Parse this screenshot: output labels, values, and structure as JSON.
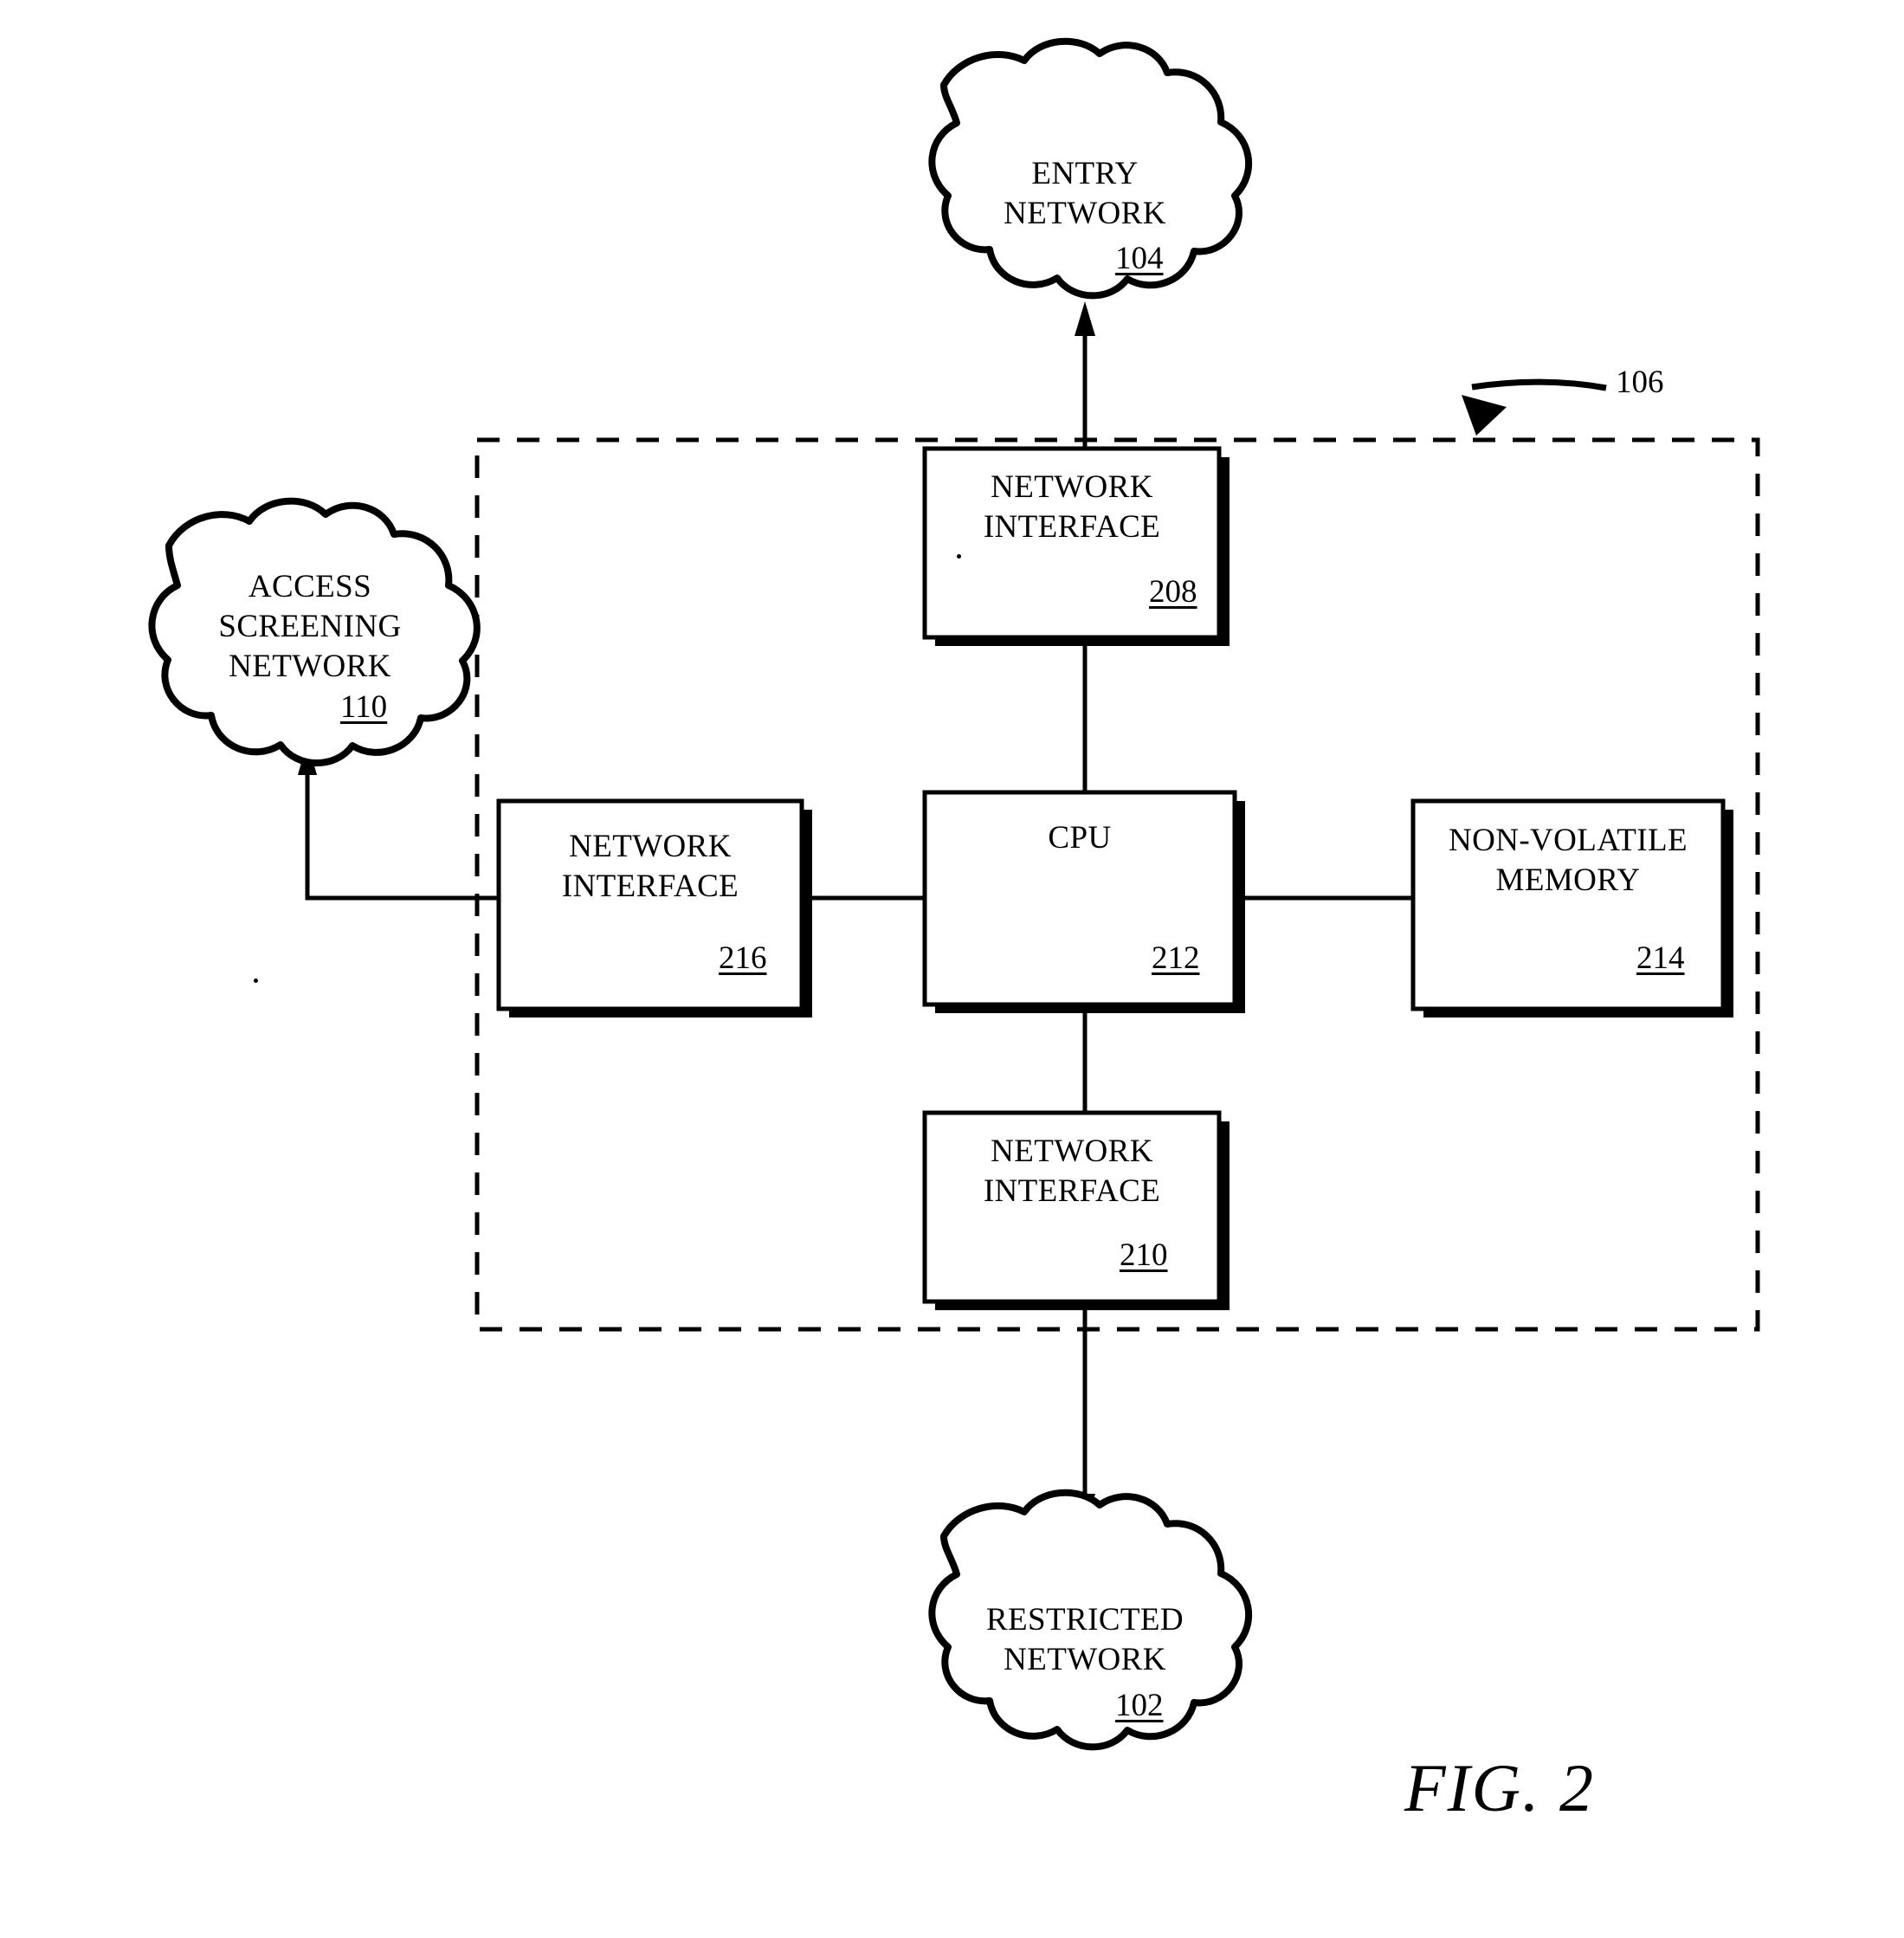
{
  "figure": {
    "caption": "FIG. 2",
    "boundary_ref": "106"
  },
  "clouds": [
    {
      "id": "entry-network",
      "label": "ENTRY\nNETWORK",
      "ref": "104"
    },
    {
      "id": "access-screening-network",
      "label": "ACCESS\nSCREENING\nNETWORK",
      "ref": "110"
    },
    {
      "id": "restricted-network",
      "label": "RESTRICTED\nNETWORK",
      "ref": "102"
    }
  ],
  "boxes": [
    {
      "id": "network-interface-208",
      "label": "NETWORK\nINTERFACE",
      "ref": "208"
    },
    {
      "id": "network-interface-216",
      "label": "NETWORK\nINTERFACE",
      "ref": "216"
    },
    {
      "id": "cpu-212",
      "label": "CPU",
      "ref": "212"
    },
    {
      "id": "non-volatile-memory-214",
      "label": "NON-VOLATILE\nMEMORY",
      "ref": "214"
    },
    {
      "id": "network-interface-210",
      "label": "NETWORK\nINTERFACE",
      "ref": "210"
    }
  ],
  "connections": [
    {
      "id": "entry-to-ni208",
      "from": "network-interface-208",
      "to": "entry-network",
      "arrow": "up"
    },
    {
      "id": "ni208-to-cpu",
      "from": "network-interface-208",
      "to": "cpu-212",
      "arrow": "none"
    },
    {
      "id": "ni216-to-cpu",
      "from": "network-interface-216",
      "to": "cpu-212",
      "arrow": "none"
    },
    {
      "id": "cpu-to-nvm",
      "from": "cpu-212",
      "to": "non-volatile-memory-214",
      "arrow": "none"
    },
    {
      "id": "cpu-to-ni210",
      "from": "cpu-212",
      "to": "network-interface-210",
      "arrow": "none"
    },
    {
      "id": "ni210-to-restricted",
      "from": "network-interface-210",
      "to": "restricted-network",
      "arrow": "down"
    },
    {
      "id": "ni216-to-access-screening",
      "from": "network-interface-216",
      "to": "access-screening-network",
      "arrow": "up"
    }
  ],
  "style": {
    "ink": "#000000",
    "paper": "#ffffff"
  }
}
